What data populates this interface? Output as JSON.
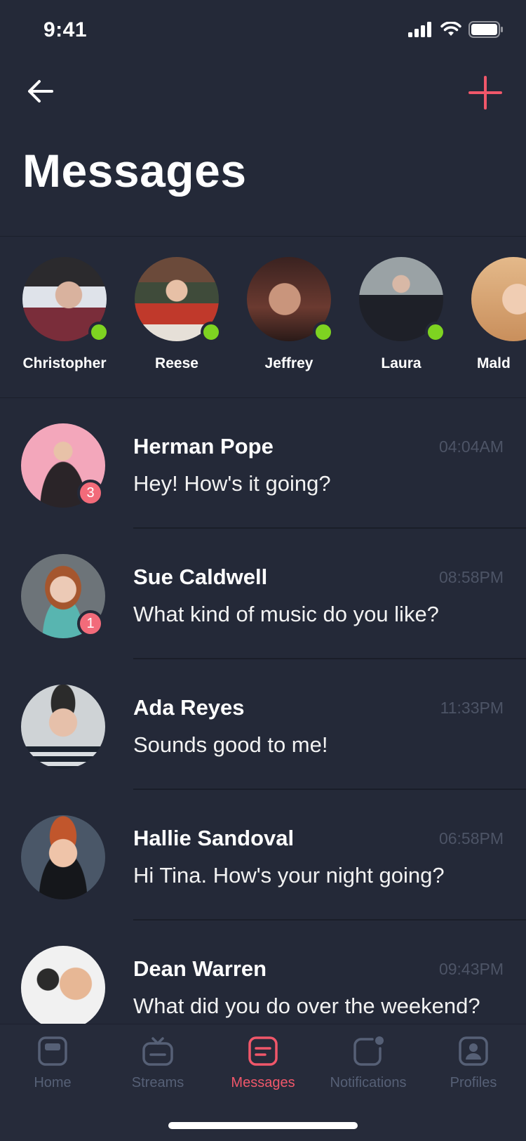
{
  "status": {
    "time": "9:41"
  },
  "header": {
    "title": "Messages"
  },
  "colors": {
    "background": "#242938",
    "accent": "#f0576a",
    "online": "#7ed321",
    "badge": "#f26b7a"
  },
  "stories": [
    {
      "name": "Christopher",
      "online": true
    },
    {
      "name": "Reese",
      "online": true
    },
    {
      "name": "Jeffrey",
      "online": true
    },
    {
      "name": "Laura",
      "online": true
    },
    {
      "name": "Mald",
      "online": false
    }
  ],
  "conversations": [
    {
      "name": "Herman Pope",
      "time": "04:04AM",
      "message": "Hey! How's it going?",
      "unread": "3"
    },
    {
      "name": "Sue Caldwell",
      "time": "08:58PM",
      "message": "What kind of music do you like?",
      "unread": "1"
    },
    {
      "name": "Ada Reyes",
      "time": "11:33PM",
      "message": "Sounds good to me!",
      "unread": ""
    },
    {
      "name": "Hallie Sandoval",
      "time": "06:58PM",
      "message": "Hi Tina. How's your night going?",
      "unread": ""
    },
    {
      "name": "Dean Warren",
      "time": "09:43PM",
      "message": "What did you do over the weekend?",
      "unread": ""
    }
  ],
  "tabs": [
    {
      "label": "Home",
      "icon": "home-icon"
    },
    {
      "label": "Streams",
      "icon": "streams-icon"
    },
    {
      "label": "Messages",
      "icon": "messages-icon",
      "active": true
    },
    {
      "label": "Notifications",
      "icon": "notifications-icon"
    },
    {
      "label": "Profiles",
      "icon": "profiles-icon"
    }
  ]
}
